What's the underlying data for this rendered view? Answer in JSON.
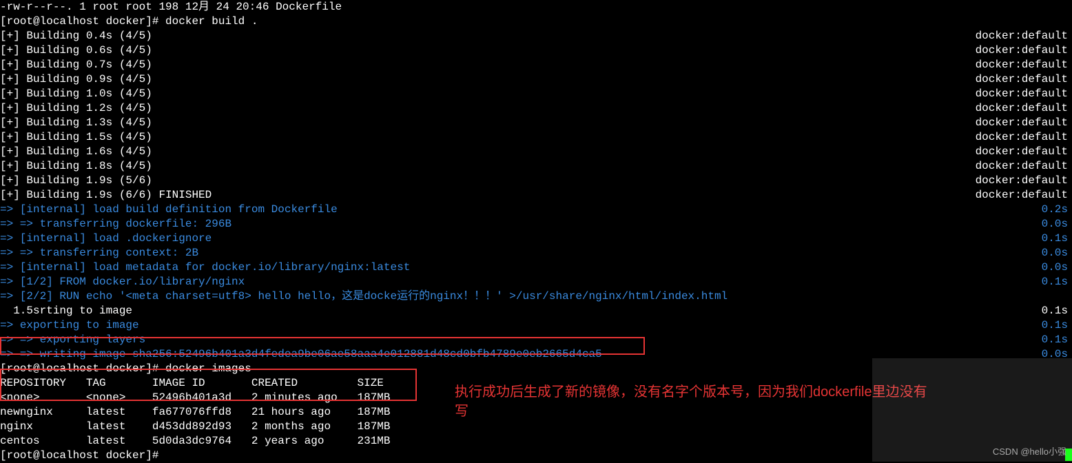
{
  "top_file_line": "-rw-r--r--. 1 root root 198 12月 24 20:46 Dockerfile",
  "prompt1": "[root@localhost docker]# docker build .",
  "build_lines": [
    {
      "left": "[+] Building 0.4s (4/5)",
      "right": "docker:default"
    },
    {
      "left": "[+] Building 0.6s (4/5)",
      "right": "docker:default"
    },
    {
      "left": "[+] Building 0.7s (4/5)",
      "right": "docker:default"
    },
    {
      "left": "[+] Building 0.9s (4/5)",
      "right": "docker:default"
    },
    {
      "left": "[+] Building 1.0s (4/5)",
      "right": "docker:default"
    },
    {
      "left": "[+] Building 1.2s (4/5)",
      "right": "docker:default"
    },
    {
      "left": "[+] Building 1.3s (4/5)",
      "right": "docker:default"
    },
    {
      "left": "[+] Building 1.5s (4/5)",
      "right": "docker:default"
    },
    {
      "left": "[+] Building 1.6s (4/5)",
      "right": "docker:default"
    },
    {
      "left": "[+] Building 1.8s (4/5)",
      "right": "docker:default"
    },
    {
      "left": "[+] Building 1.9s (5/6)",
      "right": "docker:default"
    },
    {
      "left": "[+] Building 1.9s (6/6) FINISHED",
      "right": "docker:default"
    }
  ],
  "step_lines": [
    {
      "text": "=> [internal] load build definition from Dockerfile",
      "time": "0.2s"
    },
    {
      "text": "=> => transferring dockerfile: 296B",
      "time": "0.0s"
    },
    {
      "text": "=> [internal] load .dockerignore",
      "time": "0.1s"
    },
    {
      "text": "=> => transferring context: 2B",
      "time": "0.0s"
    },
    {
      "text": "=> [internal] load metadata for docker.io/library/nginx:latest",
      "time": "0.0s"
    },
    {
      "text": "=> [1/2] FROM docker.io/library/nginx",
      "time": "0.1s"
    },
    {
      "text": "=> [2/2] RUN echo '<meta charset=utf8> hello hello，这是docke运行的nginx！！！' >/usr/share/nginx/html/index.html",
      "time": ""
    }
  ],
  "mixed_line": {
    "prefix_white": "  1.5s",
    "suffix_white": "rting to image",
    "time": "0.1s"
  },
  "export_lines": [
    {
      "text": "=> exporting to image",
      "time": "0.1s"
    },
    {
      "text": "=> => exporting layers",
      "time": "0.1s"
    },
    {
      "text": "=> => writing image sha256:52496b401a3d4fedea9be06ae58aaa4e012881d48cd0bfb4789e0eb2665d4ca5",
      "time": "0.0s"
    }
  ],
  "prompt2": "[root@localhost docker]# docker images",
  "table_header": "REPOSITORY   TAG       IMAGE ID       CREATED         SIZE",
  "table_rows": [
    "<none>       <none>    52496b401a3d   2 minutes ago   187MB",
    "newnginx     latest    fa677076ffd8   21 hours ago    187MB",
    "nginx        latest    d453dd892d93   2 months ago    187MB",
    "centos       latest    5d0da3dc9764   2 years ago     231MB"
  ],
  "prompt3": "[root@localhost docker]# ",
  "annotation": "执行成功后生成了新的镜像，没有名字个版本号，因为我们dockerfile里边没有写",
  "watermark": "CSDN @hello小强"
}
